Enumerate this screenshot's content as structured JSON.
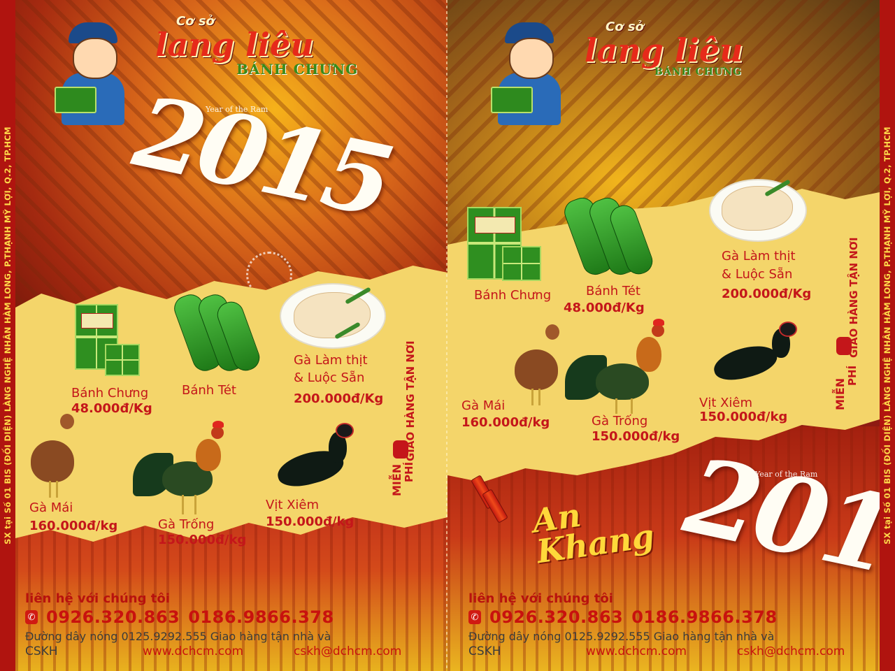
{
  "side": {
    "text": "SX tại Số 01 BIS (ĐỐI DIỆN) LÀNG NGHỆ NHÂN HÀM LONG, P.THẠNH MỸ LỢI, Q.2, TP.HCM"
  },
  "brand": {
    "co_so": "Cơ sở",
    "name": "lang liêu",
    "sub": "BÁNH CHƯNG",
    "year_of_ram": "Year of the Ram"
  },
  "year": "2015",
  "greeting": {
    "line1": "An",
    "line2": "Khang"
  },
  "products": [
    {
      "name": "Bánh Chưng",
      "price": "48.000đ/Kg"
    },
    {
      "name": "Bánh Tét",
      "price": ""
    },
    {
      "name": "Gà Làm thịt",
      "name2": "& Luộc Sẵn",
      "price": "200.000đ/Kg"
    },
    {
      "name": "Gà Mái",
      "price": "160.000đ/kg"
    },
    {
      "name": "Gà Trống",
      "price": "150.000đ/kg"
    },
    {
      "name": "Vịt Xiêm",
      "price": "150.000đ/kg"
    }
  ],
  "products_right": [
    {
      "name": "Bánh Chưng",
      "price": ""
    },
    {
      "name": "Bánh Tét",
      "price": "48.000đ/Kg"
    },
    {
      "name": "Gà Làm thịt",
      "name2": "& Luộc Sẵn",
      "price": "200.000đ/Kg"
    },
    {
      "name": "Gà Mái",
      "price": "160.000đ/kg"
    },
    {
      "name": "Gà Trống",
      "price": "150.000đ/kg"
    },
    {
      "name": "Vịt Xiêm",
      "price": "150.000đ/kg"
    }
  ],
  "delivery": {
    "free_1": "MIỄN",
    "free_2": "PHÍ",
    "text": "GIAO HÀNG TẬN NƠI"
  },
  "contact": {
    "title": "liên hệ với chúng tôi",
    "phone_1": "0926.320.863",
    "phone_2": "0186.9866.378",
    "hotline": "Đường dây nóng 0125.9292.555 Giao hàng tận nhà và",
    "cskh": "CSKH",
    "website": "www.dchcm.com",
    "email": "cskh@dchcm.com"
  },
  "colors": {
    "red": "#c4161a",
    "gold": "#f4d56a",
    "green": "#2f8f20"
  }
}
